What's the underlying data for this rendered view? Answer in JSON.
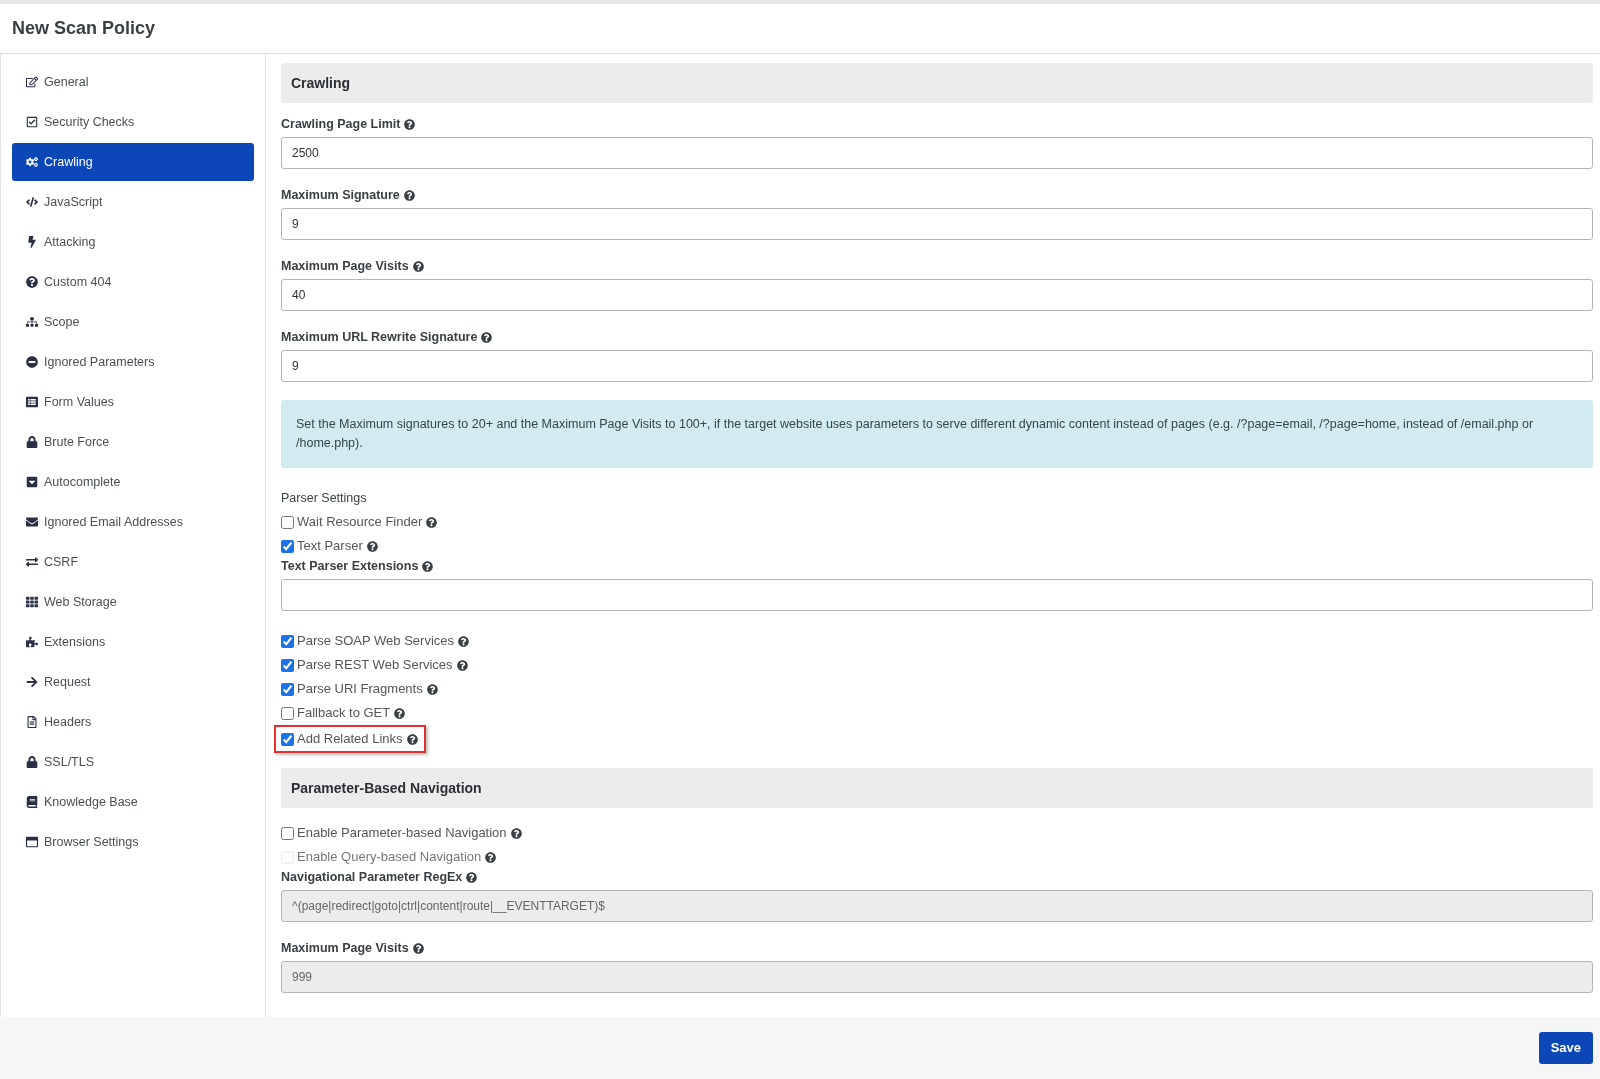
{
  "header": {
    "title": "New Scan Policy"
  },
  "sidebar": {
    "items": [
      {
        "label": "General",
        "selected": false
      },
      {
        "label": "Security Checks",
        "selected": false
      },
      {
        "label": "Crawling",
        "selected": true
      },
      {
        "label": "JavaScript",
        "selected": false
      },
      {
        "label": "Attacking",
        "selected": false
      },
      {
        "label": "Custom 404",
        "selected": false
      },
      {
        "label": "Scope",
        "selected": false
      },
      {
        "label": "Ignored Parameters",
        "selected": false
      },
      {
        "label": "Form Values",
        "selected": false
      },
      {
        "label": "Brute Force",
        "selected": false
      },
      {
        "label": "Autocomplete",
        "selected": false
      },
      {
        "label": "Ignored Email Addresses",
        "selected": false
      },
      {
        "label": "CSRF",
        "selected": false
      },
      {
        "label": "Web Storage",
        "selected": false
      },
      {
        "label": "Extensions",
        "selected": false
      },
      {
        "label": "Request",
        "selected": false
      },
      {
        "label": "Headers",
        "selected": false
      },
      {
        "label": "SSL/TLS",
        "selected": false
      },
      {
        "label": "Knowledge Base",
        "selected": false
      },
      {
        "label": "Browser Settings",
        "selected": false
      }
    ]
  },
  "sections": [
    {
      "heading": "Crawling",
      "items": [
        {
          "kind": "field",
          "label": "Crawling Page Limit",
          "value": "2500",
          "disabled": false
        },
        {
          "kind": "field",
          "label": "Maximum Signature",
          "value": "9",
          "disabled": false
        },
        {
          "kind": "field",
          "label": "Maximum Page Visits",
          "value": "40",
          "disabled": false
        },
        {
          "kind": "field",
          "label": "Maximum URL Rewrite Signature",
          "value": "9",
          "disabled": false
        },
        {
          "kind": "note",
          "text": "Set the Maximum signatures to 20+ and the Maximum Page Visits to 100+, if the target website uses parameters to serve different dynamic content instead of pages (e.g. /?page=email, /?page=home, instead of /email.php or /home.php)."
        },
        {
          "kind": "group",
          "label": "Parser Settings"
        },
        {
          "kind": "checkbox",
          "label": "Wait Resource Finder",
          "checked": false,
          "disabled": false,
          "highlighted": false
        },
        {
          "kind": "checkbox",
          "label": "Text Parser",
          "checked": true,
          "disabled": false,
          "highlighted": false
        },
        {
          "kind": "field",
          "label": "Text Parser Extensions",
          "value": "",
          "disabled": false
        },
        {
          "kind": "checkbox",
          "label": "Parse SOAP Web Services",
          "checked": true,
          "disabled": false,
          "highlighted": false
        },
        {
          "kind": "checkbox",
          "label": "Parse REST Web Services",
          "checked": true,
          "disabled": false,
          "highlighted": false
        },
        {
          "kind": "checkbox",
          "label": "Parse URI Fragments",
          "checked": true,
          "disabled": false,
          "highlighted": false
        },
        {
          "kind": "checkbox",
          "label": "Fallback to GET",
          "checked": false,
          "disabled": false,
          "highlighted": false
        },
        {
          "kind": "checkbox",
          "label": "Add Related Links",
          "checked": true,
          "disabled": false,
          "highlighted": true
        }
      ]
    },
    {
      "heading": "Parameter-Based Navigation",
      "items": [
        {
          "kind": "checkbox",
          "label": "Enable Parameter-based Navigation",
          "checked": false,
          "disabled": false,
          "highlighted": false
        },
        {
          "kind": "checkbox",
          "label": "Enable Query-based Navigation",
          "checked": false,
          "disabled": true,
          "highlighted": false
        },
        {
          "kind": "field",
          "label": "Navigational Parameter RegEx",
          "value": "^(page|redirect|goto|ctrl|content|route|__EVENTTARGET)$",
          "disabled": true
        },
        {
          "kind": "field",
          "label": "Maximum Page Visits",
          "value": "999",
          "disabled": true
        }
      ]
    }
  ],
  "footer": {
    "save": "Save"
  }
}
